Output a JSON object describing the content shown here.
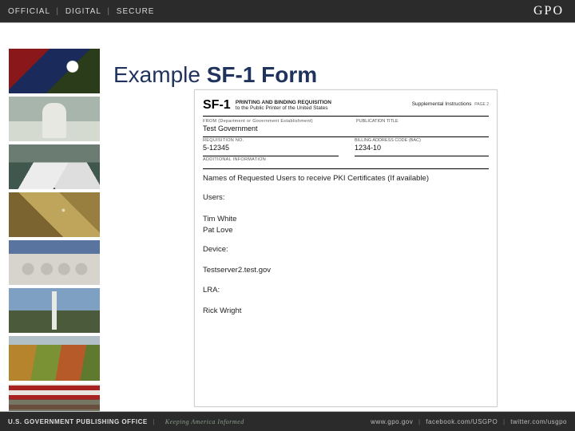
{
  "topbar": {
    "word1": "OFFICIAL",
    "word2": "DIGITAL",
    "word3": "SECURE",
    "brand": "GPO"
  },
  "title": {
    "prefix": "Example ",
    "bold": "SF-1 Form"
  },
  "form": {
    "code": "SF-1",
    "sub_line1": "PRINTING AND BINDING REQUISITION",
    "sub_line2": "to the Public Printer of the United States",
    "supplemental": "Supplemental Instructions",
    "supplemental_page": "PAGE 2",
    "from_label": "FROM (Department or Government Establishment)",
    "from_value": "Test Government",
    "pubtitle_label": "PUBLICATION TITLE",
    "req_label": "REQUISITION NO.",
    "req_value": "5-12345",
    "bac_label": "BILLING ADDRESS CODE (BAC)",
    "bac_value": "1234-10",
    "addl_label": "ADDITIONAL INFORMATION",
    "body_title": "Names of Requested Users to receive PKI Certificates (If available)",
    "users_label": "Users:",
    "user1": "Tim White",
    "user2": "Pat Love",
    "device_label": "Device:",
    "device1": "Testserver2.test.gov",
    "lra_label": "LRA:",
    "lra1": "Rick Wright"
  },
  "bottombar": {
    "office": "U.S. GOVERNMENT PUBLISHING OFFICE",
    "tagline": "Keeping America Informed",
    "link1": "www.gpo.gov",
    "link2": "facebook.com/USGPO",
    "link3": "twitter.com/usgpo"
  }
}
